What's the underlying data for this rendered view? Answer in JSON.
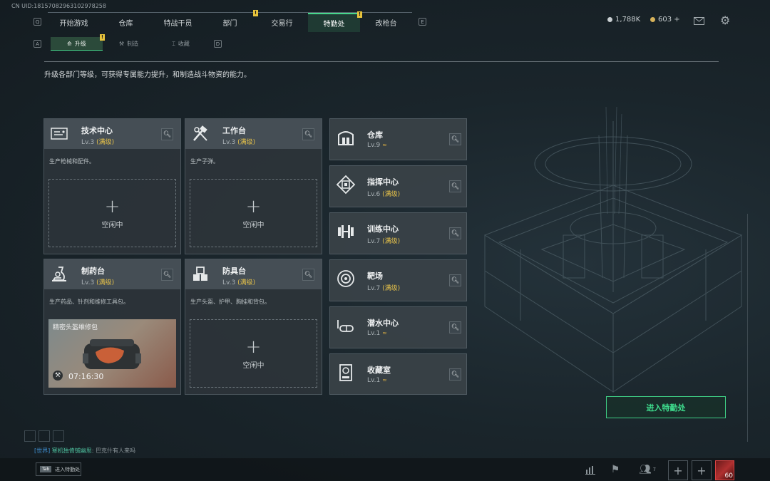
{
  "uid": "CN UID:18157082963102978258",
  "nav": {
    "left_key": "Q",
    "right_key": "E",
    "tabs": [
      {
        "label": "开始游戏",
        "active": false,
        "badge": ""
      },
      {
        "label": "仓库",
        "active": false,
        "badge": ""
      },
      {
        "label": "特战干员",
        "active": false,
        "badge": ""
      },
      {
        "label": "部门",
        "active": false,
        "badge": "!"
      },
      {
        "label": "交易行",
        "active": false,
        "badge": ""
      },
      {
        "label": "特勤处",
        "active": true,
        "badge": "!"
      },
      {
        "label": "改枪台",
        "active": false,
        "badge": ""
      }
    ]
  },
  "subnav": {
    "left_key": "A",
    "right_key": "D",
    "tabs": [
      {
        "label": "升级",
        "icon": "upgrade-icon",
        "active": true,
        "badge": "!"
      },
      {
        "label": "制造",
        "icon": "craft-icon",
        "active": false,
        "badge": ""
      },
      {
        "label": "收藏",
        "icon": "collection-icon",
        "active": false,
        "badge": ""
      }
    ]
  },
  "currency": {
    "coins": "1,788K",
    "tokens": "603",
    "tokens_plus": "+"
  },
  "description": "升级各部门等级，可获得专属能力提升，和制造战斗物资的能力。",
  "big_cards": [
    {
      "title": "技术中心",
      "level": "Lv.3",
      "max": "(满级)",
      "sub": "生产枪械和配件。",
      "icon": "tech-center-icon",
      "slot_plus": "+",
      "slot_text": "空闲中"
    },
    {
      "title": "工作台",
      "level": "Lv.3",
      "max": "(满级)",
      "sub": "生产子弹。",
      "icon": "workbench-icon",
      "slot_plus": "+",
      "slot_text": "空闲中"
    },
    {
      "title": "制药台",
      "level": "Lv.3",
      "max": "(满级)",
      "sub": "生产药品、针剂和维修工具包。",
      "icon": "pharmacy-icon",
      "item_name": "精密头盔维修包",
      "timer": "07:16:30"
    },
    {
      "title": "防具台",
      "level": "Lv.3",
      "max": "(满级)",
      "sub": "生产头盔、护甲、胸挂和背包。",
      "icon": "armor-bench-icon",
      "slot_plus": "+",
      "slot_text": "空闲中"
    }
  ],
  "small_cards": [
    {
      "title": "仓库",
      "level": "Lv.9",
      "max": "",
      "icon": "warehouse-icon"
    },
    {
      "title": "指挥中心",
      "level": "Lv.6",
      "max": "(满级)",
      "icon": "command-center-icon"
    },
    {
      "title": "训练中心",
      "level": "Lv.7",
      "max": "(满级)",
      "icon": "training-center-icon"
    },
    {
      "title": "靶场",
      "level": "Lv.7",
      "max": "(满级)",
      "icon": "shooting-range-icon"
    },
    {
      "title": "潜水中心",
      "level": "Lv.1",
      "max": "",
      "icon": "diving-center-icon"
    },
    {
      "title": "收藏室",
      "level": "Lv.1",
      "max": "",
      "icon": "collection-room-icon"
    }
  ],
  "enter_button": "进入特勤处",
  "chat": {
    "channel": "[世界]",
    "name": "寒机独倚铖幽思",
    "message": "巴克什有人来吗"
  },
  "tab_hint": {
    "key": "Tab",
    "label": "进入特勤处"
  },
  "friends_count": "7",
  "player_level": "60",
  "colors": {
    "accent": "#47d98c",
    "max_level": "#e6c24a",
    "badge": "#e8c43c"
  }
}
